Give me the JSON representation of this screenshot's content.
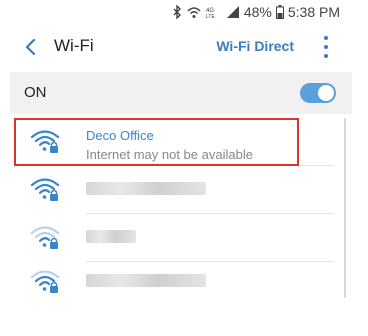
{
  "status_bar": {
    "icons": [
      "bluetooth-icon",
      "wifi-calling-icon",
      "4g-lte-signal-icon",
      "signal-bars-icon",
      "battery-icon"
    ],
    "battery_text": "48%",
    "time": "5:38 PM"
  },
  "app_bar": {
    "back_icon": "back-arrow-icon",
    "title": "Wi-Fi",
    "wifi_direct_label": "Wi-Fi Direct",
    "more_icon": "more-vert-icon"
  },
  "wifi_toggle": {
    "label": "ON",
    "state": "on",
    "accent_color": "#5aa0dd"
  },
  "networks": [
    {
      "name": "Deco Office",
      "status": "Internet may not be available",
      "secured": true,
      "highlighted": true
    },
    {
      "name": "",
      "secured": true,
      "redacted": true
    },
    {
      "name": "",
      "secured": true,
      "redacted": true
    },
    {
      "name": "",
      "secured": true,
      "redacted": true
    }
  ],
  "colors": {
    "link": "#3a7cc2",
    "highlight_box": "#d9352f",
    "network_name": "#3a86c8"
  }
}
